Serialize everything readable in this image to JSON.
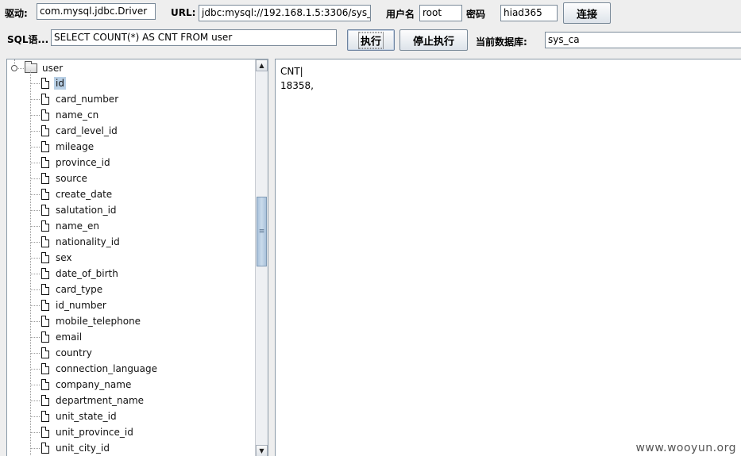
{
  "toolbar": {
    "driver_label": "驱动:",
    "driver_value": "com.mysql.jdbc.Driver",
    "url_label": "URL:",
    "url_value": "jdbc:mysql://192.168.1.5:3306/sys_ca?",
    "user_label": "用户名",
    "user_value": "root",
    "password_label": "密码",
    "password_value": "hiad365",
    "connect_label": "连接",
    "sql_label": "SQL语...",
    "sql_value": "SELECT COUNT(*) AS CNT FROM user",
    "execute_label": "执行",
    "stop_label": "停止执行",
    "current_db_label": "当前数据库:",
    "current_db_value": "sys_ca"
  },
  "tree": {
    "root_label": "user",
    "columns": [
      {
        "name": "id",
        "selected": true
      },
      {
        "name": "card_number"
      },
      {
        "name": "name_cn"
      },
      {
        "name": "card_level_id"
      },
      {
        "name": "mileage"
      },
      {
        "name": "province_id"
      },
      {
        "name": "source"
      },
      {
        "name": "create_date"
      },
      {
        "name": "salutation_id"
      },
      {
        "name": "name_en"
      },
      {
        "name": "nationality_id"
      },
      {
        "name": "sex"
      },
      {
        "name": "date_of_birth"
      },
      {
        "name": "card_type"
      },
      {
        "name": "id_number"
      },
      {
        "name": "mobile_telephone"
      },
      {
        "name": "email"
      },
      {
        "name": "country"
      },
      {
        "name": "connection_language"
      },
      {
        "name": "company_name"
      },
      {
        "name": "department_name"
      },
      {
        "name": "unit_state_id"
      },
      {
        "name": "unit_province_id"
      },
      {
        "name": "unit_city_id"
      }
    ]
  },
  "result": {
    "header": "CNT|",
    "value": "18358,"
  },
  "watermark": "www.wooyun.org"
}
